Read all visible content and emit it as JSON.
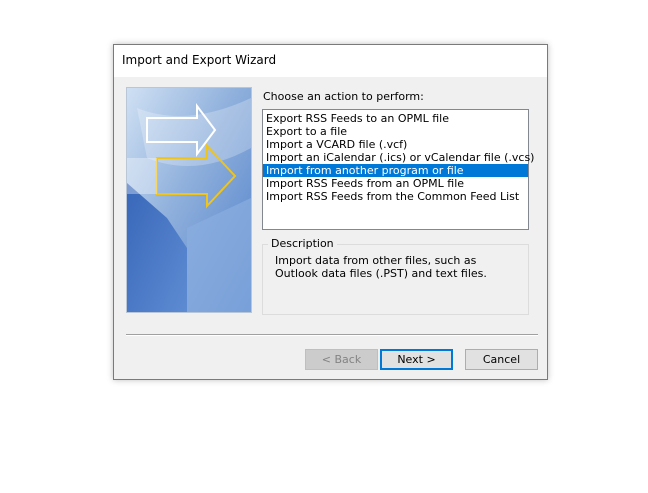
{
  "window": {
    "title": "Import and Export Wizard"
  },
  "prompt": "Choose an action to perform:",
  "actions": [
    "Export RSS Feeds to an OPML file",
    "Export to a file",
    "Import a VCARD file (.vcf)",
    "Import an iCalendar (.ics) or vCalendar file (.vcs)",
    "Import from another program or file",
    "Import RSS Feeds from an OPML file",
    "Import RSS Feeds from the Common Feed List"
  ],
  "selected_action": "Import from another program or file",
  "description": {
    "label": "Description",
    "text": "Import data from other files, such as Outlook data files (.PST) and text files."
  },
  "buttons": {
    "back": "< Back",
    "next": "Next >",
    "cancel": "Cancel"
  },
  "colors": {
    "selection": "#0078d7",
    "banner_blue": "#3a6cc4",
    "arrow_yellow": "#f0c419"
  }
}
